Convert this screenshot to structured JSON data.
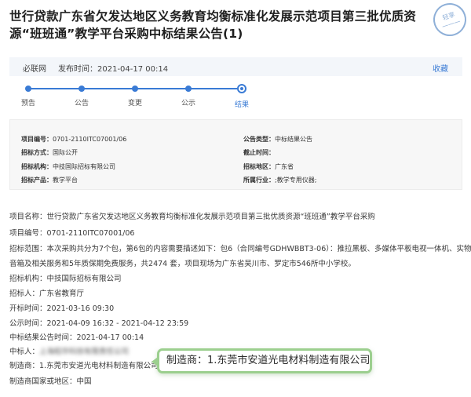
{
  "title": "世行贷款广东省欠发达地区义务教育均衡标准化发展示范项目第三批优质资源“班班通”教学平台采购中标结果公告(1)",
  "stamp": {
    "line1": "轻享",
    "line2": "一一一"
  },
  "meta": {
    "source": "必联网",
    "pubtime": "发布时间：2021-04-17 00:14",
    "favorite": "收藏"
  },
  "steps": [
    {
      "label": "预告"
    },
    {
      "label": "公告"
    },
    {
      "label": "变更"
    },
    {
      "label": "公示"
    },
    {
      "label": "结果"
    }
  ],
  "info": {
    "project_no_k": "项目编号：",
    "project_no_v": "0701-2110ITC07001/06",
    "notice_type_k": "公告类型：",
    "notice_type_v": "中标结果公告",
    "bid_method_k": "招标方式：",
    "bid_method_v": "国际公开",
    "deadline_k": "截止时间：",
    "deadline_v": "",
    "agency_k": "招标机构：",
    "agency_v": "中技国际招标有限公司",
    "region_k": "招标地区：",
    "region_v": "广东省",
    "product_k": "招标产品：",
    "product_v": "教学平台",
    "industry_k": "所属行业：",
    "industry_v": ";教学专用仪器;"
  },
  "content": {
    "project_name": "项目名称：世行贷款广东省欠发达地区义务教育均衡标准化发展示范项目第三批优质资源“班班通”教学平台采购",
    "project_no": "项目编号：0701-2110ITC07001/06",
    "scope_line1": "招标范围：本次采购共分为7个包，第6包的内容需要描述如下：包6（合同编号GDHWBBT3-06）：推拉黑板、多媒体平板电视一体机、实物展台、",
    "scope_line2": "音箱及相关服务和5年质保期免费服务，共2474 套，项目现场为广东省吴川市、罗定市546所中小学校。",
    "agency": "招标机构：中技国际招标有限公司",
    "buyer": "招标人：广东省教育厅",
    "open_time": "开标时间：2021-03-16 09:30",
    "public_time": "公示时间：2021-04-09 16:32 - 2021-04-12 23:59",
    "result_time": "中标结果公告时间：2021-04-17 00:14",
    "winner_label": "中标人：",
    "winner_value": "上海稻华科技有限责任公司",
    "maker": "制造商：1.东莞市安道光电材料制造有限公司",
    "maker_country": "制造商国家或地区：中国"
  },
  "callout": {
    "text": "制造商：1.东莞市安道光电材料制造有限公司"
  }
}
